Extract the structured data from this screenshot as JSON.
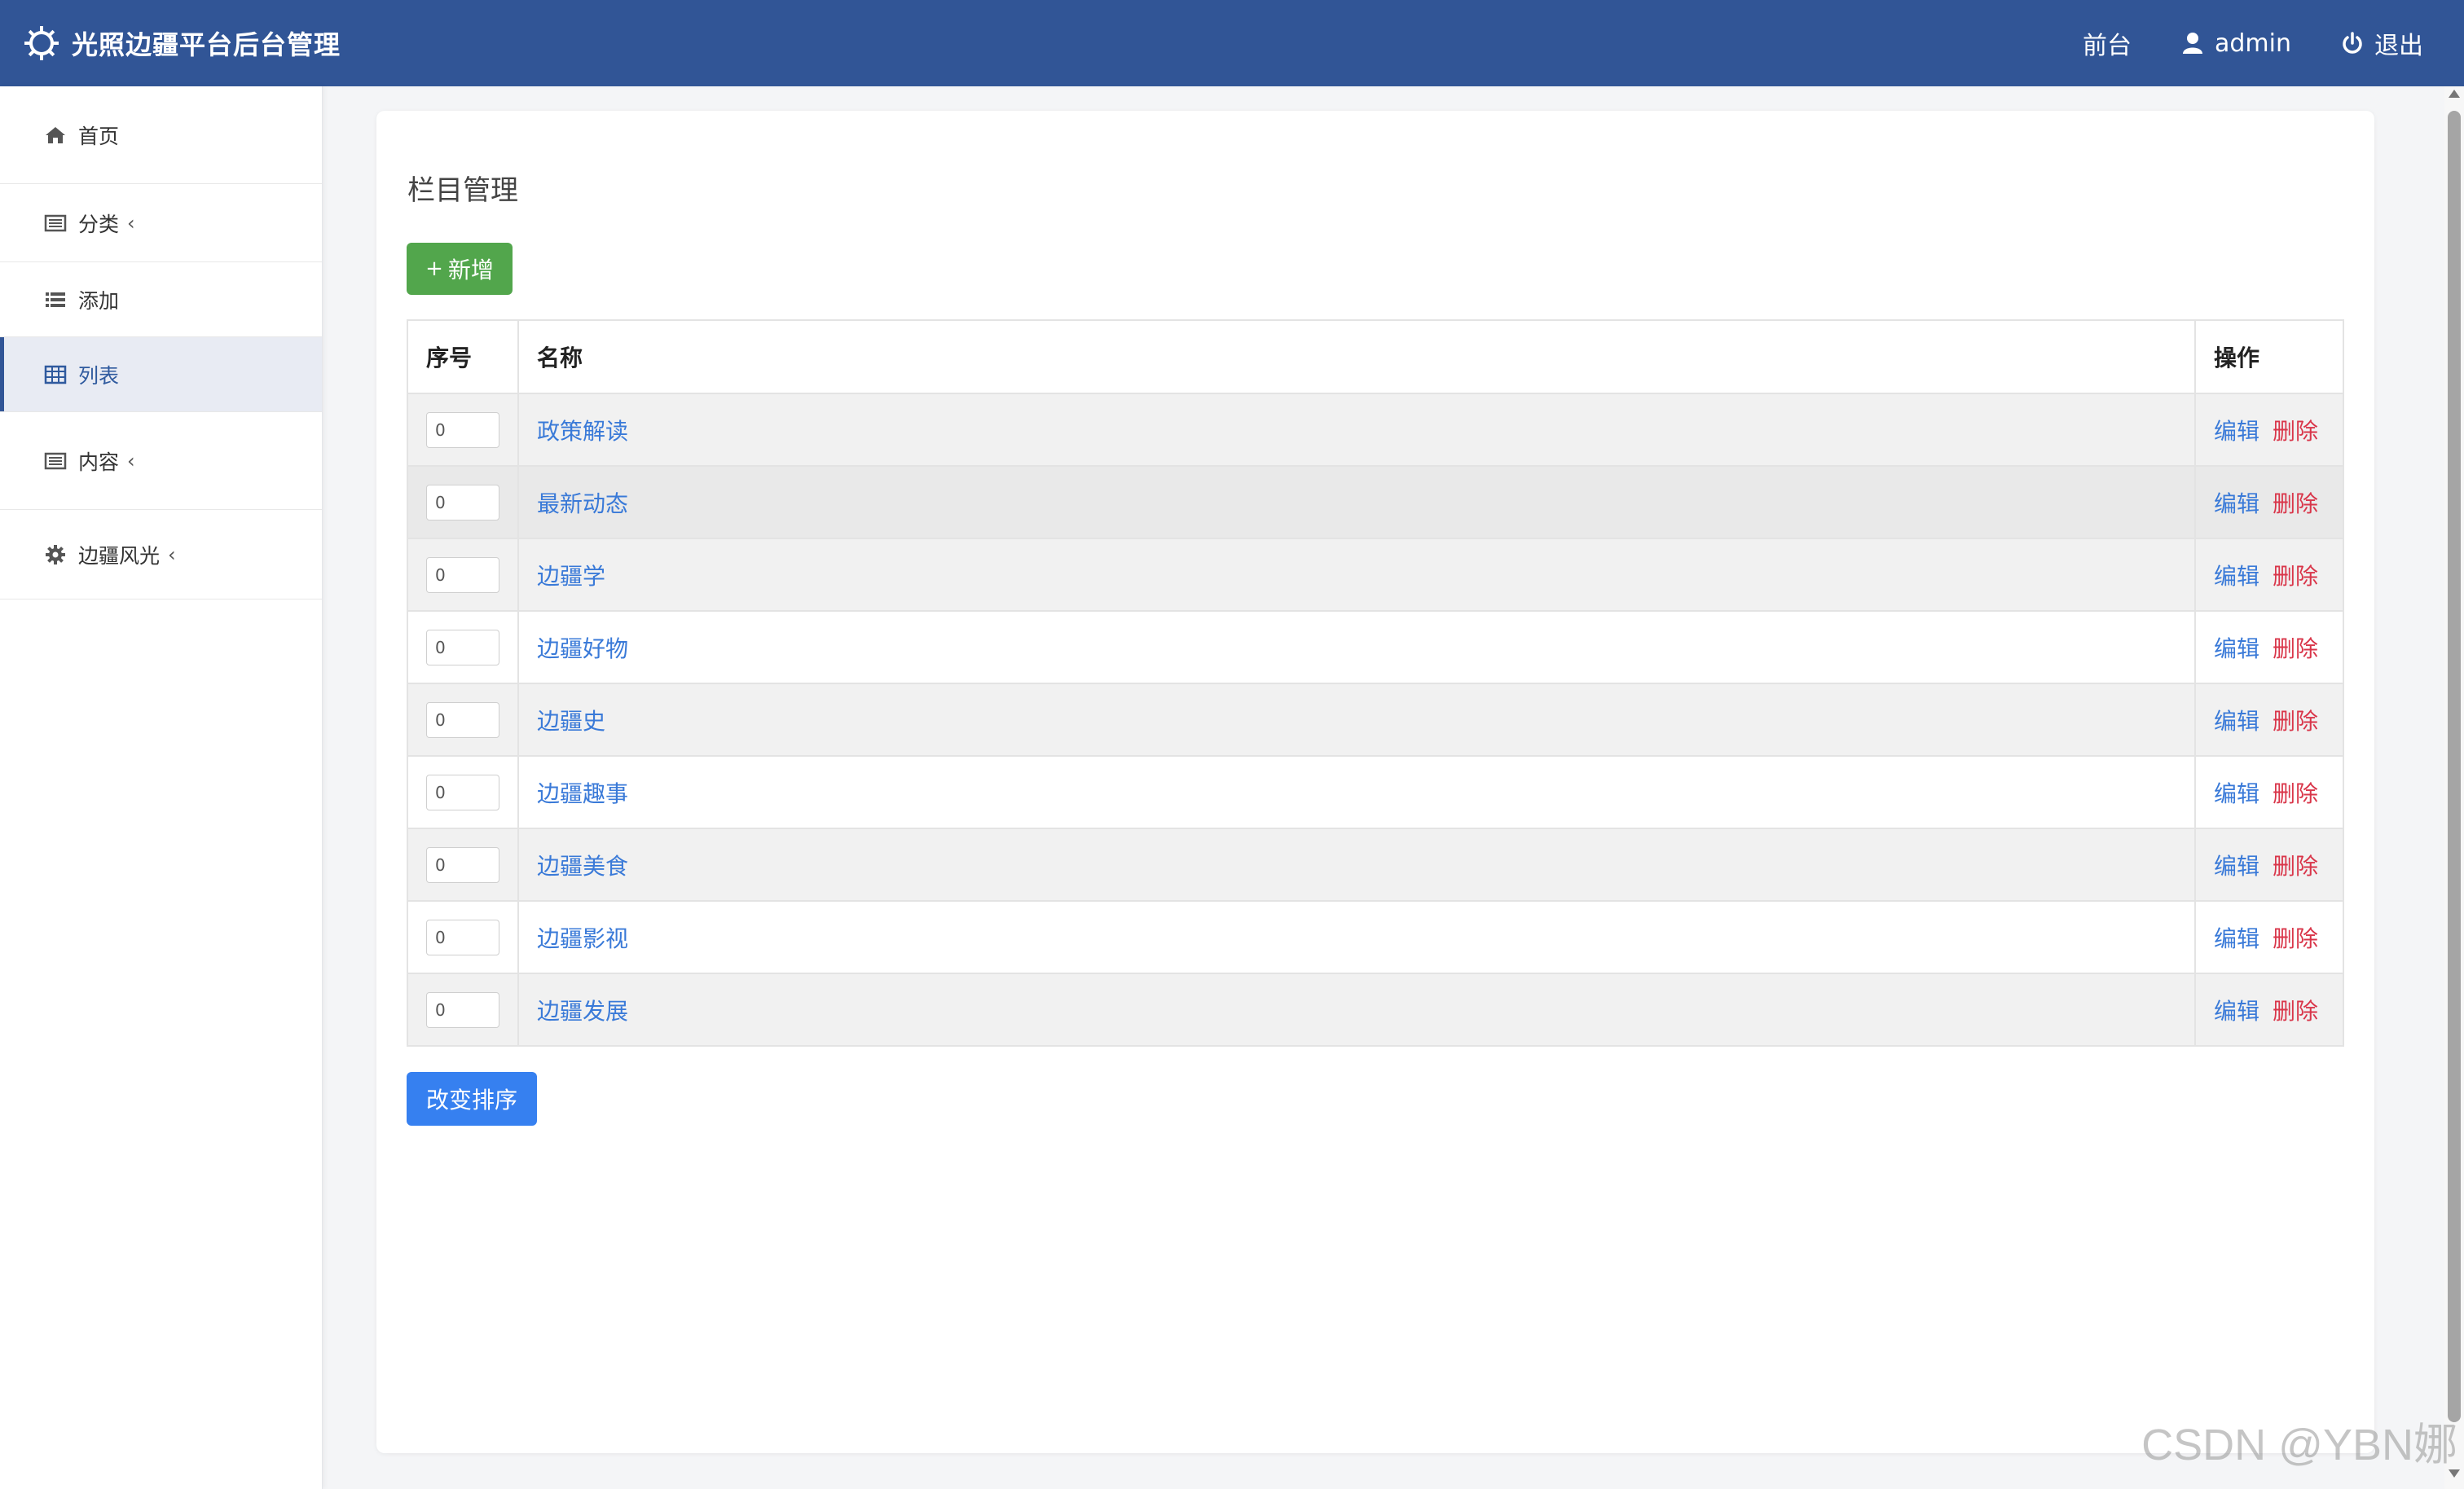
{
  "header": {
    "title": "光照边疆平台后台管理",
    "front_label": "前台",
    "user_label": "admin",
    "logout_label": "退出"
  },
  "sidebar": {
    "items": [
      {
        "label": "首页",
        "icon": "home-icon"
      },
      {
        "label": "分类",
        "icon": "list-alt-icon",
        "chevron": "‹"
      },
      {
        "label": "添加",
        "icon": "list-icon"
      },
      {
        "label": "列表",
        "icon": "table-icon"
      },
      {
        "label": "内容",
        "icon": "list-alt-icon",
        "chevron": "‹"
      },
      {
        "label": "边疆风光",
        "icon": "gear-icon",
        "chevron": "‹"
      }
    ]
  },
  "main": {
    "title": "栏目管理",
    "add_button": "新增",
    "add_plus": "+",
    "sort_button": "改变排序",
    "table": {
      "headers": [
        "序号",
        "名称",
        "操作"
      ],
      "edit_label": "编辑",
      "delete_label": "删除",
      "rows": [
        {
          "order": "0",
          "name": "政策解读"
        },
        {
          "order": "0",
          "name": "最新动态"
        },
        {
          "order": "0",
          "name": "边疆学"
        },
        {
          "order": "0",
          "name": "边疆好物"
        },
        {
          "order": "0",
          "name": "边疆史"
        },
        {
          "order": "0",
          "name": "边疆趣事"
        },
        {
          "order": "0",
          "name": "边疆美食"
        },
        {
          "order": "0",
          "name": "边疆影视"
        },
        {
          "order": "0",
          "name": "边疆发展"
        }
      ]
    }
  },
  "watermark": "CSDN @YBN娜",
  "colors": {
    "header_bg": "#315596",
    "add_button": "#52a64c",
    "sort_button": "#3680f0",
    "link": "#3a7ad8",
    "delete": "#d9364a"
  }
}
